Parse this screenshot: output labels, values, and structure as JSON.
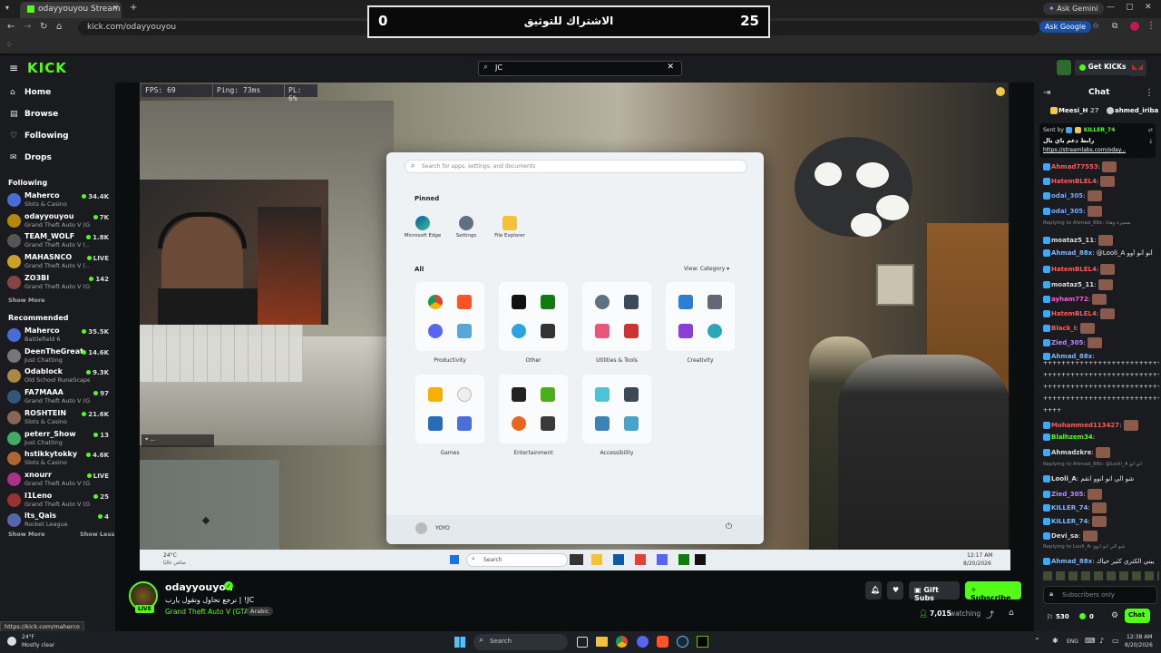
{
  "browser": {
    "tab_title": "odayyouyou Stream - Wat",
    "url": "kick.com/odayyouyou",
    "ask_gemini": "Ask Gemini",
    "ask_google": "Ask Google"
  },
  "score_banner": {
    "left": "0",
    "center": "الاشتراك للتوثيق",
    "right": "25"
  },
  "header": {
    "logo": "KICK",
    "search_value": "JC",
    "get_kicks": "Get KICKs"
  },
  "sidebar": {
    "nav": [
      "Home",
      "Browse",
      "Following",
      "Drops"
    ],
    "following_title": "Following",
    "following": [
      {
        "name": "Maherco",
        "game": "Slots & Casino",
        "viewers": "34.4K",
        "color": "#4a6bd6"
      },
      {
        "name": "odayyouyou",
        "game": "Grand Theft Auto V (GTA)",
        "viewers": "7K",
        "color": "#b8860b"
      },
      {
        "name": "TEAM_WOLF",
        "game": "Grand Theft Auto V (...",
        "viewers": "1.8K",
        "color": "#555"
      },
      {
        "name": "MAHASNCO",
        "game": "Grand Theft Auto V (...",
        "viewers": "LIVE",
        "color": "#c9a227"
      },
      {
        "name": "ZO3BI",
        "game": "Grand Theft Auto V (G...",
        "viewers": "142",
        "color": "#884444"
      }
    ],
    "show_more": "Show More",
    "recommended_title": "Recommended",
    "recommended": [
      {
        "name": "Maherco",
        "game": "Battlefield 6",
        "viewers": "35.5K",
        "color": "#4a6bd6"
      },
      {
        "name": "DeenTheGreat",
        "game": "Just Chatting",
        "viewers": "14.6K",
        "color": "#777"
      },
      {
        "name": "Odablock",
        "game": "Old School RuneScape",
        "viewers": "9.3K",
        "color": "#aa8844"
      },
      {
        "name": "FA7MAAA",
        "game": "Grand Theft Auto V (GTA)",
        "viewers": "97",
        "color": "#335577"
      },
      {
        "name": "ROSHTEIN",
        "game": "Slots & Casino",
        "viewers": "21.6K",
        "color": "#886655"
      },
      {
        "name": "peterr_Show",
        "game": "Just Chatting",
        "viewers": "13",
        "color": "#44aa66"
      },
      {
        "name": "hstikkytokky",
        "game": "Slots & Casino",
        "viewers": "4.6K",
        "color": "#aa6633"
      },
      {
        "name": "xnourr",
        "game": "Grand Theft Auto V (GTA)",
        "viewers": "LIVE",
        "color": "#aa3388"
      },
      {
        "name": "I1Leno",
        "game": "Grand Theft Auto V (GTA)",
        "viewers": "25",
        "color": "#993333"
      },
      {
        "name": "its_Qais",
        "game": "Rocket League",
        "viewers": "4",
        "color": "#5566aa"
      }
    ],
    "show_more2": "Show More",
    "show_less": "Show Less"
  },
  "hud": {
    "fps": "FPS: 69",
    "ping": "Ping: 73ms",
    "pl": "PL: 6%"
  },
  "start_menu": {
    "search_placeholder": "Search for apps, settings, and documents",
    "pinned_label": "Pinned",
    "pinned": [
      "Microsoft Edge",
      "Settings",
      "File Explorer"
    ],
    "all_label": "All",
    "view_label": "View: Category",
    "folders_row1": [
      "Productivity",
      "Other",
      "Utilities & Tools",
      "Creativity"
    ],
    "folders_row2": [
      "Games",
      "Entertainment",
      "Accessibility"
    ],
    "user": "YOYO"
  },
  "game_taskbar": {
    "weather_temp": "24°C",
    "weather_desc": "صافي غالبًا",
    "search": "Search",
    "time": "12:17 AM",
    "date": "8/20/2026"
  },
  "stream_info": {
    "channel": "odayyouyou",
    "title": "نرجع نحاول ونقول يارب | !JC",
    "category": "Grand Theft Auto V (GTA)",
    "tag": "Arabic",
    "live_label": "LIVE",
    "gift_subs": "Gift Subs",
    "subscribe": "Subscribe",
    "watching_count": "7,015",
    "watching_label": "watching"
  },
  "chat": {
    "title": "Chat",
    "top_users": [
      {
        "name": "Meesi_H",
        "count": "27"
      },
      {
        "name": "ahmed_iriba",
        "count": ""
      }
    ],
    "pinned": {
      "sent_by": "Sent by",
      "sender": "KILLER_74",
      "text": "رابط دعم ياي يال",
      "link": "https://streamlabs.com/oday..."
    },
    "messages": [
      {
        "user": "Ahmad77553",
        "text": ":",
        "color": "#ff5a5a",
        "emote": true
      },
      {
        "user": "HatemBLEL4",
        "text": ":",
        "color": "#ff5a5a",
        "emote": true
      },
      {
        "user": "odai_305",
        "text": ":",
        "color": "#7aa8ff",
        "emote": true
      },
      {
        "user": "odai_305",
        "text": ":",
        "color": "#7aa8ff",
        "emote": true
      },
      {
        "user": "",
        "text": "Replying to Ahmad_88x: مسيرة وهانا",
        "color": "#888",
        "emote": false,
        "reply": true
      },
      {
        "user": "moataz5_11",
        "text": ":",
        "color": "#dddddd",
        "emote": true
      },
      {
        "user": "Ahmad_88x",
        "text": ": @Looli_A أنو أنو أوو",
        "color": "#7ab8ff",
        "emote": false
      },
      {
        "user": "HatemBLEL4",
        "text": ":",
        "color": "#ff5a5a",
        "emote": true
      },
      {
        "user": "moataz5_11",
        "text": ":",
        "color": "#dddddd",
        "emote": true
      },
      {
        "user": "ayham772",
        "text": ":",
        "color": "#ff5ad0",
        "emote": true
      },
      {
        "user": "HatemBLEL4",
        "text": ":",
        "color": "#ff5a5a",
        "emote": true
      },
      {
        "user": "Black_I",
        "text": ":",
        "color": "#ff5a5a",
        "emote": true
      },
      {
        "user": "Zied_305",
        "text": ":",
        "color": "#b58cff",
        "emote": true
      },
      {
        "user": "Ahmad_88x",
        "text": ":",
        "color": "#7ab8ff",
        "emote": false
      }
    ],
    "flood": "++++++++++++++++++++++++++++++++++++",
    "flood_end": "++++",
    "messages2": [
      {
        "user": "Mohammed113427",
        "text": ":",
        "color": "#ff5a5a",
        "emote": true
      },
      {
        "user": "Blalhzem34",
        "text": ":",
        "color": "#53fc18",
        "emote": false
      },
      {
        "user": "Ahmadzkre",
        "text": ":",
        "color": "#dddddd",
        "emote": true
      },
      {
        "user": "",
        "text": "Replying to Ahmad_88x: @Looli_A أنو أنو",
        "color": "#888",
        "emote": false,
        "reply": true
      },
      {
        "user": "Looli_A",
        "text": ": شو الي انو انوو انقم",
        "color": "#dddddd",
        "emote": false
      },
      {
        "user": "Zied_305",
        "text": ":",
        "color": "#b58cff",
        "emote": true
      },
      {
        "user": "KILLER_74",
        "text": ":",
        "color": "#7ab8ff",
        "emote": true
      },
      {
        "user": "KILLER_74",
        "text": ":",
        "color": "#7ab8ff",
        "emote": true
      },
      {
        "user": "Devi_sa",
        "text": ":",
        "color": "#dddddd",
        "emote": true
      },
      {
        "user": "",
        "text": "Replying to Looli_A: شو الي انو انوو",
        "color": "#888",
        "emote": false,
        "reply": true
      },
      {
        "user": "Ahmad_88x",
        "text": ": يبني الكتري كثير حياك",
        "color": "#7ab8ff",
        "emote": false
      }
    ],
    "input_placeholder": "Subscribers only",
    "points": "530",
    "zero": "0",
    "chat_button": "Chat"
  },
  "statusbar": {
    "link": "https://kick.com/maherco"
  },
  "windows_taskbar": {
    "weather_temp": "24°F",
    "weather_desc": "Mostly clear",
    "search": "Search",
    "lang": "ENG",
    "time": "12:38 AM",
    "date": "8/20/2026"
  }
}
